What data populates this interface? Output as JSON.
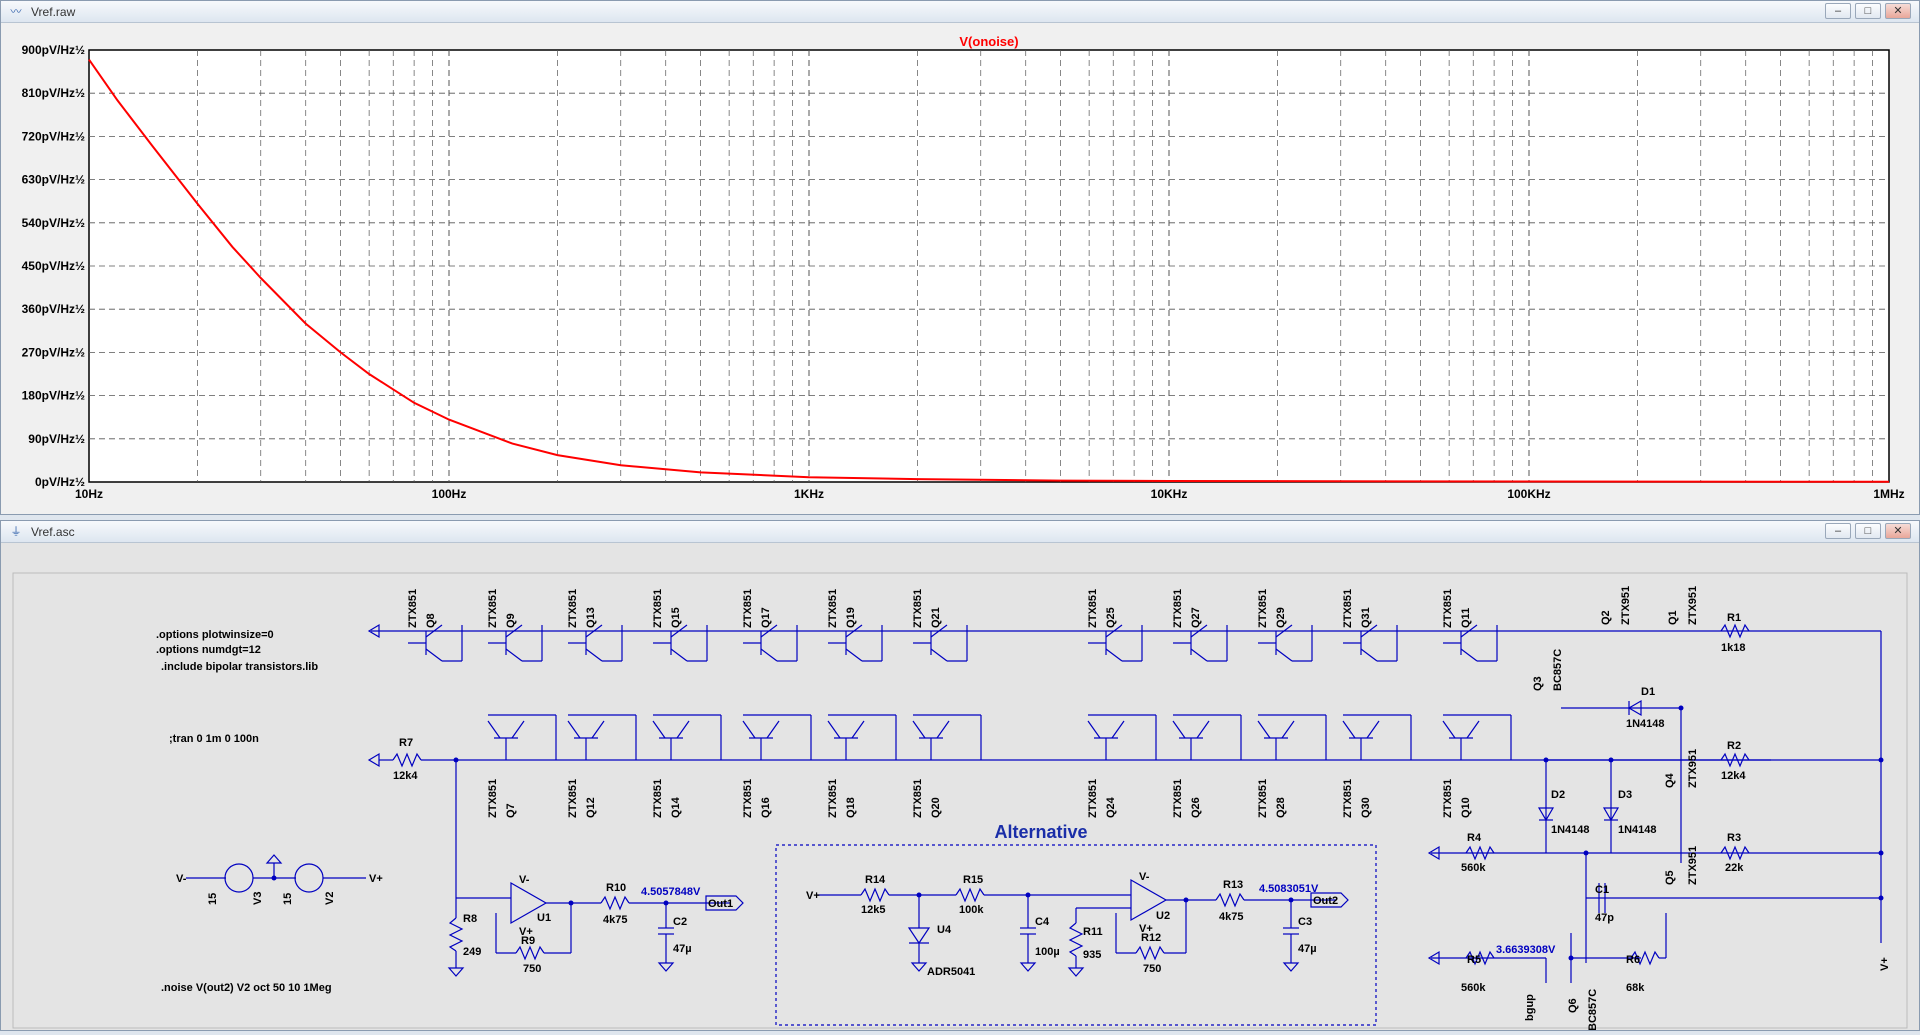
{
  "plot_window": {
    "title": "Vref.raw",
    "trace_name": "V(onoise)",
    "trace_color": "#ff0000",
    "y_ticks": [
      "0pV/Hz½",
      "90pV/Hz½",
      "180pV/Hz½",
      "270pV/Hz½",
      "360pV/Hz½",
      "450pV/Hz½",
      "540pV/Hz½",
      "630pV/Hz½",
      "720pV/Hz½",
      "810pV/Hz½",
      "900pV/Hz½"
    ],
    "x_ticks": [
      "10Hz",
      "100Hz",
      "1KHz",
      "10KHz",
      "100KHz",
      "1MHz"
    ]
  },
  "chart_data": {
    "type": "line",
    "title": "V(onoise)",
    "xlabel": "",
    "ylabel": "",
    "x_scale": "log",
    "xlim_hz": [
      10,
      1000000
    ],
    "ylim_pv_per_rthz": [
      0,
      900
    ],
    "grid": true,
    "series": [
      {
        "name": "V(onoise)",
        "x_hz": [
          10,
          12,
          15,
          20,
          25,
          30,
          40,
          50,
          60,
          80,
          100,
          150,
          200,
          300,
          500,
          1000,
          2000,
          5000,
          10000,
          100000,
          1000000
        ],
        "y_pv_per_rthz": [
          880,
          795,
          700,
          580,
          490,
          425,
          330,
          270,
          225,
          165,
          130,
          80,
          56,
          35,
          20,
          10,
          6,
          3,
          2,
          1,
          0.5
        ]
      }
    ]
  },
  "schematic_window": {
    "title": "Vref.asc",
    "directives": {
      "plotwinsize": ".options plotwinsize=0",
      "numdgt": ".options numdgt=12",
      "include": ".include bipolar transistors.lib",
      "tran": ";tran 0 1m 0 100n",
      "noise": ".noise V(out2) V2 oct 50 10 1Meg"
    },
    "alternative_label": "Alternative",
    "wire_color": "#0000c0",
    "transistors_top": [
      {
        "model": "ZTX851",
        "ref": "Q8"
      },
      {
        "model": "ZTX851",
        "ref": "Q9"
      },
      {
        "model": "ZTX851",
        "ref": "Q13"
      },
      {
        "model": "ZTX851",
        "ref": "Q15"
      },
      {
        "model": "ZTX851",
        "ref": "Q17"
      },
      {
        "model": "ZTX851",
        "ref": "Q19"
      },
      {
        "model": "ZTX851",
        "ref": "Q21"
      },
      {
        "model": "ZTX851",
        "ref": "Q25"
      },
      {
        "model": "ZTX851",
        "ref": "Q27"
      },
      {
        "model": "ZTX851",
        "ref": "Q29"
      },
      {
        "model": "ZTX851",
        "ref": "Q31"
      },
      {
        "model": "ZTX851",
        "ref": "Q11"
      }
    ],
    "transistors_bottom": [
      {
        "model": "ZTX851",
        "ref": "Q7"
      },
      {
        "model": "ZTX851",
        "ref": "Q12"
      },
      {
        "model": "ZTX851",
        "ref": "Q14"
      },
      {
        "model": "ZTX851",
        "ref": "Q16"
      },
      {
        "model": "ZTX851",
        "ref": "Q18"
      },
      {
        "model": "ZTX851",
        "ref": "Q20"
      },
      {
        "model": "ZTX851",
        "ref": "Q24"
      },
      {
        "model": "ZTX851",
        "ref": "Q26"
      },
      {
        "model": "ZTX851",
        "ref": "Q28"
      },
      {
        "model": "ZTX851",
        "ref": "Q30"
      },
      {
        "model": "ZTX851",
        "ref": "Q10"
      }
    ],
    "right_transistors": {
      "q2_ref": "Q2",
      "q2_model": "ZTX951",
      "q1_ref": "Q1",
      "q1_model": "ZTX951",
      "q3_ref": "Q3",
      "q3_model": "BC857C",
      "q4_ref": "Q4",
      "q4_model": "ZTX951",
      "q5_ref": "Q5",
      "q5_model": "ZTX951",
      "q6_ref": "Q6",
      "q6_model": "BC857C"
    },
    "resistors": {
      "r1": {
        "ref": "R1",
        "value": "1k18"
      },
      "r2": {
        "ref": "R2",
        "value": "12k4"
      },
      "r3": {
        "ref": "R3",
        "value": "22k"
      },
      "r4": {
        "ref": "R4",
        "value": "560k"
      },
      "r5": {
        "ref": "R5",
        "value": "560k"
      },
      "r6": {
        "ref": "R6",
        "value": "68k"
      },
      "r7": {
        "ref": "R7",
        "value": "12k4"
      },
      "r8": {
        "ref": "R8",
        "value": "249"
      },
      "r9": {
        "ref": "R9",
        "value": "750"
      },
      "r10": {
        "ref": "R10",
        "value": "4k75"
      },
      "r11": {
        "ref": "R11",
        "value": "935"
      },
      "r12": {
        "ref": "R12",
        "value": "750"
      },
      "r13": {
        "ref": "R13",
        "value": "4k75"
      },
      "r14": {
        "ref": "R14",
        "value": "12k5"
      },
      "r15": {
        "ref": "R15",
        "value": "100k"
      }
    },
    "capacitors": {
      "c1": {
        "ref": "C1",
        "value": "47p"
      },
      "c2": {
        "ref": "C2",
        "value": "47µ"
      },
      "c3": {
        "ref": "C3",
        "value": "47µ"
      },
      "c4": {
        "ref": "C4",
        "value": "100µ"
      }
    },
    "diodes": {
      "d1": {
        "ref": "D1",
        "value": "1N4148"
      },
      "d2": {
        "ref": "D2",
        "value": "1N4148"
      },
      "d3": {
        "ref": "D3",
        "value": "1N4148"
      }
    },
    "opamps": {
      "u1": "U1",
      "u2": "U2",
      "u4": "U4",
      "u4_model": "ADR5041",
      "vminus": "V-",
      "vplus": "V+"
    },
    "sources": {
      "v3": {
        "ref": "V3",
        "value": "15"
      },
      "v2": {
        "ref": "V2",
        "value": "15"
      },
      "vminus": "V-",
      "vplus": "V+"
    },
    "nets": {
      "out1": "Out1",
      "out2": "Out2",
      "out1_voltage": "4.5057848V",
      "out2_voltage": "4.5083051V",
      "bgup": "bgup",
      "bgup_voltage": "3.6639308V",
      "vplus": "V+"
    }
  }
}
